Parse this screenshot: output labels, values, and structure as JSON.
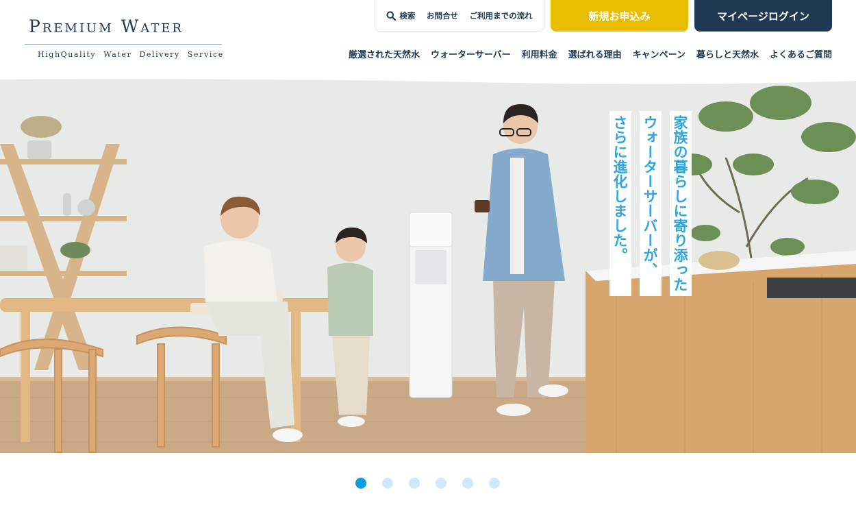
{
  "logo": {
    "main": "Premium Water",
    "tagline": "HighQuality Water Delivery Service"
  },
  "utility_nav": {
    "search": "検索",
    "contact": "お問合せ",
    "flow": "ご利用までの流れ"
  },
  "cta": {
    "new_application": "新規お申込み",
    "mypage_login": "マイページログイン"
  },
  "global_nav": [
    {
      "label": "厳選された天然水"
    },
    {
      "label": "ウォーターサーバー"
    },
    {
      "label": "利用料金"
    },
    {
      "label": "選ばれる理由"
    },
    {
      "label": "キャンペーン"
    },
    {
      "label": "暮らしと天然水"
    },
    {
      "label": "よくあるご質問"
    }
  ],
  "hero": {
    "copy_lines": [
      "家族の暮らしに寄り添った",
      "ウォーターサーバーが、",
      "さらに進化しました。"
    ]
  },
  "carousel": {
    "slide_count": 6,
    "active_index": 0
  },
  "colors": {
    "navy": "#1f3a52",
    "yellow": "#e8bd00",
    "copy_blue": "#2ea6dc",
    "dot_active": "#0b9be3",
    "dot_inactive": "#cfe9f8"
  }
}
